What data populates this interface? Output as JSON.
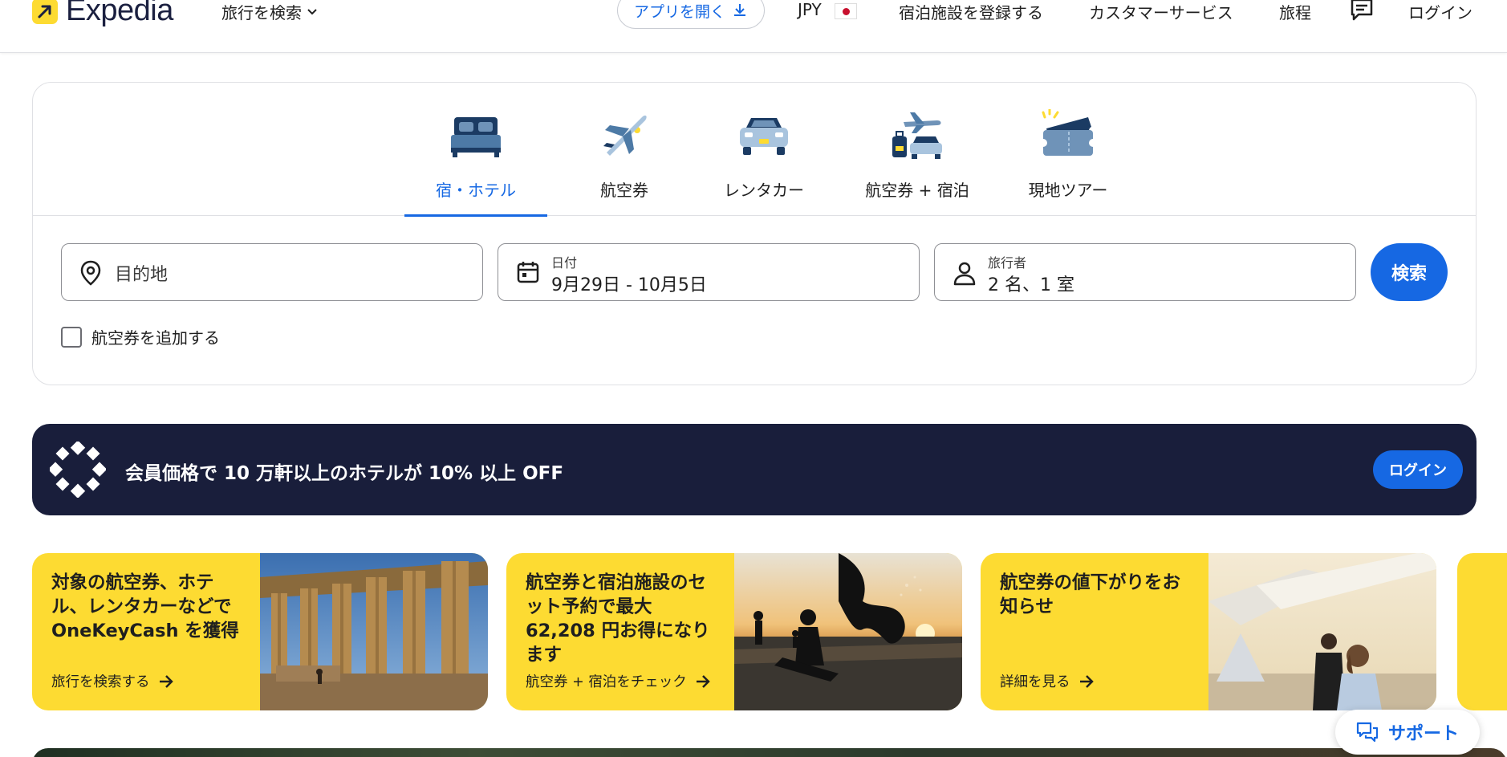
{
  "header": {
    "brand": "Expedia",
    "trips_menu": "旅行を検索",
    "app_button": "アプリを開く",
    "currency": "JPY",
    "list_property": "宿泊施設を登録する",
    "customer_service": "カスタマーサービス",
    "itinerary": "旅程",
    "login": "ログイン"
  },
  "tabs": [
    {
      "label": "宿・ホテル",
      "icon": "bed-icon",
      "active": true
    },
    {
      "label": "航空券",
      "icon": "airplane-icon",
      "active": false
    },
    {
      "label": "レンタカー",
      "icon": "car-icon",
      "active": false
    },
    {
      "label": "航空券 + 宿泊",
      "icon": "flight-hotel-icon",
      "active": false
    },
    {
      "label": "現地ツアー",
      "icon": "ticket-icon",
      "active": false
    }
  ],
  "search": {
    "destination_placeholder": "目的地",
    "dates_label": "日付",
    "dates_value": "9月29日 - 10月5日",
    "travelers_label": "旅行者",
    "travelers_value": "2 名、1 室",
    "search_button": "検索",
    "add_flight": "航空券を追加する"
  },
  "member_banner": {
    "text": "会員価格で 10 万軒以上のホテルが 10% 以上 OFF",
    "login_button": "ログイン"
  },
  "promos": [
    {
      "title": "対象の航空券、ホテル、レンタカーなどで OneKeyCash を獲得",
      "link": "旅行を検索する"
    },
    {
      "title": "航空券と宿泊施設のセット予約で最大 62,208 円お得になります",
      "link": "航空券 + 宿泊をチェック"
    },
    {
      "title": "航空券の値下がりをお知らせ",
      "link": "詳細を見る"
    }
  ],
  "support_button": "サポート",
  "colors": {
    "accent": "#1668e3",
    "navy": "#191e3b",
    "yellow": "#fddb32"
  }
}
